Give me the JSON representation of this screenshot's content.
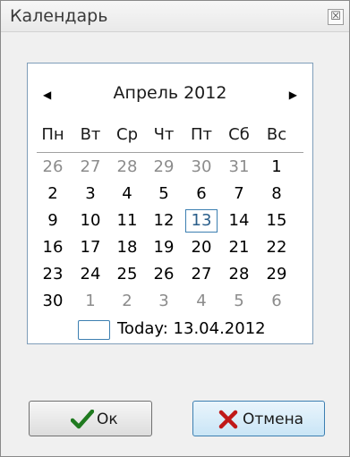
{
  "window": {
    "title": "Календарь",
    "close_glyph": "☒"
  },
  "calendar": {
    "prev_glyph": "◀",
    "next_glyph": "▶",
    "month_title": "Апрель 2012",
    "weekdays": [
      "Пн",
      "Вт",
      "Ср",
      "Чт",
      "Пт",
      "Сб",
      "Вс"
    ],
    "weeks": [
      [
        {
          "d": "26",
          "other": true
        },
        {
          "d": "27",
          "other": true
        },
        {
          "d": "28",
          "other": true
        },
        {
          "d": "29",
          "other": true
        },
        {
          "d": "30",
          "other": true
        },
        {
          "d": "31",
          "other": true
        },
        {
          "d": "1"
        }
      ],
      [
        {
          "d": "2"
        },
        {
          "d": "3"
        },
        {
          "d": "4"
        },
        {
          "d": "5"
        },
        {
          "d": "6"
        },
        {
          "d": "7"
        },
        {
          "d": "8"
        }
      ],
      [
        {
          "d": "9"
        },
        {
          "d": "10"
        },
        {
          "d": "11"
        },
        {
          "d": "12"
        },
        {
          "d": "13",
          "today": true
        },
        {
          "d": "14"
        },
        {
          "d": "15"
        }
      ],
      [
        {
          "d": "16"
        },
        {
          "d": "17"
        },
        {
          "d": "18"
        },
        {
          "d": "19"
        },
        {
          "d": "20"
        },
        {
          "d": "21"
        },
        {
          "d": "22"
        }
      ],
      [
        {
          "d": "23"
        },
        {
          "d": "24"
        },
        {
          "d": "25"
        },
        {
          "d": "26"
        },
        {
          "d": "27"
        },
        {
          "d": "28"
        },
        {
          "d": "29"
        }
      ],
      [
        {
          "d": "30"
        },
        {
          "d": "1",
          "other": true
        },
        {
          "d": "2",
          "other": true
        },
        {
          "d": "3",
          "other": true
        },
        {
          "d": "4",
          "other": true
        },
        {
          "d": "5",
          "other": true
        },
        {
          "d": "6",
          "other": true
        }
      ]
    ],
    "today_label": "Today: 13.04.2012"
  },
  "buttons": {
    "ok_label": "Ок",
    "ok_icon": "checkmark-icon",
    "cancel_label": "Отмена",
    "cancel_icon": "cross-icon"
  },
  "colors": {
    "accent": "#3c7fb1",
    "check": "#1f7a1f",
    "cross": "#c01818"
  }
}
